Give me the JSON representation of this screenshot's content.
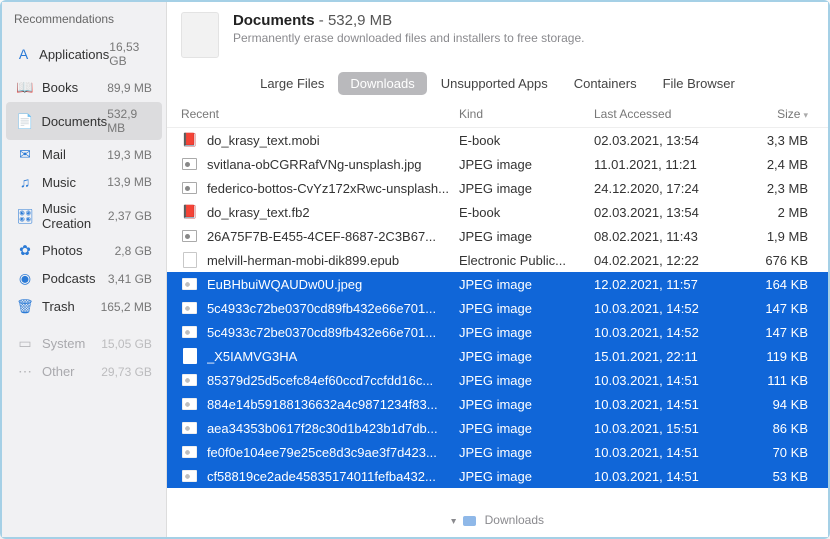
{
  "sidebar": {
    "title": "Recommendations",
    "items": [
      {
        "icon": "A",
        "label": "Applications",
        "size": "16,53 GB",
        "iconColor": "#2a7ad6"
      },
      {
        "icon": "📖",
        "label": "Books",
        "size": "89,9 MB",
        "iconColor": "#2a7ad6"
      },
      {
        "icon": "📄",
        "label": "Documents",
        "size": "532,9 MB",
        "iconColor": "#2a7ad6",
        "selected": true
      },
      {
        "icon": "✉",
        "label": "Mail",
        "size": "19,3 MB",
        "iconColor": "#2a7ad6"
      },
      {
        "icon": "♫",
        "label": "Music",
        "size": "13,9 MB",
        "iconColor": "#2a7ad6"
      },
      {
        "icon": "🎛",
        "label": "Music Creation",
        "size": "2,37 GB",
        "iconColor": "#2a7ad6"
      },
      {
        "icon": "✿",
        "label": "Photos",
        "size": "2,8 GB",
        "iconColor": "#2a7ad6"
      },
      {
        "icon": "◉",
        "label": "Podcasts",
        "size": "3,41 GB",
        "iconColor": "#2a7ad6"
      },
      {
        "icon": "🗑",
        "label": "Trash",
        "size": "165,2 MB",
        "iconColor": "#2a7ad6"
      }
    ],
    "dimItems": [
      {
        "icon": "▭",
        "label": "System",
        "size": "15,05 GB"
      },
      {
        "icon": "⋯",
        "label": "Other",
        "size": "29,73 GB"
      }
    ]
  },
  "header": {
    "titlePrefix": "Documents",
    "titleSize": " - 532,9 MB",
    "subtitle": "Permanently erase downloaded files and installers to free storage."
  },
  "tabs": [
    {
      "label": "Large Files"
    },
    {
      "label": "Downloads",
      "active": true
    },
    {
      "label": "Unsupported Apps"
    },
    {
      "label": "Containers"
    },
    {
      "label": "File Browser"
    }
  ],
  "columns": {
    "name": "Recent",
    "kind": "Kind",
    "date": "Last Accessed",
    "size": "Size"
  },
  "rows": [
    {
      "icon": "book",
      "name": "do_krasy_text.mobi",
      "kind": "E-book",
      "date": "02.03.2021, 13:54",
      "size": "3,3 MB"
    },
    {
      "icon": "img",
      "name": "svitlana-obCGRRafVNg-unsplash.jpg",
      "kind": "JPEG image",
      "date": "11.01.2021, 11:21",
      "size": "2,4 MB"
    },
    {
      "icon": "img",
      "name": "federico-bottos-CvYz172xRwc-unsplash...",
      "kind": "JPEG image",
      "date": "24.12.2020, 17:24",
      "size": "2,3 MB"
    },
    {
      "icon": "book",
      "name": "do_krasy_text.fb2",
      "kind": "E-book",
      "date": "02.03.2021, 13:54",
      "size": "2 MB"
    },
    {
      "icon": "img",
      "name": "26A75F7B-E455-4CEF-8687-2C3B67...",
      "kind": "JPEG image",
      "date": "08.02.2021, 11:43",
      "size": "1,9 MB"
    },
    {
      "icon": "doc",
      "name": "melvill-herman-mobi-dik899.epub",
      "kind": "Electronic Public...",
      "date": "04.02.2021, 12:22",
      "size": "676 KB"
    },
    {
      "icon": "img",
      "name": "EuBHbuiWQAUDw0U.jpeg",
      "kind": "JPEG image",
      "date": "12.02.2021, 11:57",
      "size": "164 KB",
      "selected": true
    },
    {
      "icon": "img",
      "name": "5c4933c72be0370cd89fb432e66e701...",
      "kind": "JPEG image",
      "date": "10.03.2021, 14:52",
      "size": "147 KB",
      "selected": true
    },
    {
      "icon": "img",
      "name": "5c4933c72be0370cd89fb432e66e701...",
      "kind": "JPEG image",
      "date": "10.03.2021, 14:52",
      "size": "147 KB",
      "selected": true
    },
    {
      "icon": "doc",
      "name": "_X5IAMVG3HA",
      "kind": "JPEG image",
      "date": "15.01.2021, 22:11",
      "size": "119 KB",
      "selected": true
    },
    {
      "icon": "img",
      "name": "85379d25d5cefc84ef60ccd7ccfdd16c...",
      "kind": "JPEG image",
      "date": "10.03.2021, 14:51",
      "size": "111 KB",
      "selected": true
    },
    {
      "icon": "img",
      "name": "884e14b59188136632a4c9871234f83...",
      "kind": "JPEG image",
      "date": "10.03.2021, 14:51",
      "size": "94 KB",
      "selected": true
    },
    {
      "icon": "img",
      "name": "aea34353b0617f28c30d1b423b1d7db...",
      "kind": "JPEG image",
      "date": "10.03.2021, 15:51",
      "size": "86 KB",
      "selected": true
    },
    {
      "icon": "img",
      "name": "fe0f0e104ee79e25ce8d3c9ae3f7d423...",
      "kind": "JPEG image",
      "date": "10.03.2021, 14:51",
      "size": "70 KB",
      "selected": true
    },
    {
      "icon": "img",
      "name": "cf58819ce2ade45835174011fefba432...",
      "kind": "JPEG image",
      "date": "10.03.2021, 14:51",
      "size": "53 KB",
      "selected": true
    }
  ],
  "footer": {
    "path": "Downloads"
  }
}
